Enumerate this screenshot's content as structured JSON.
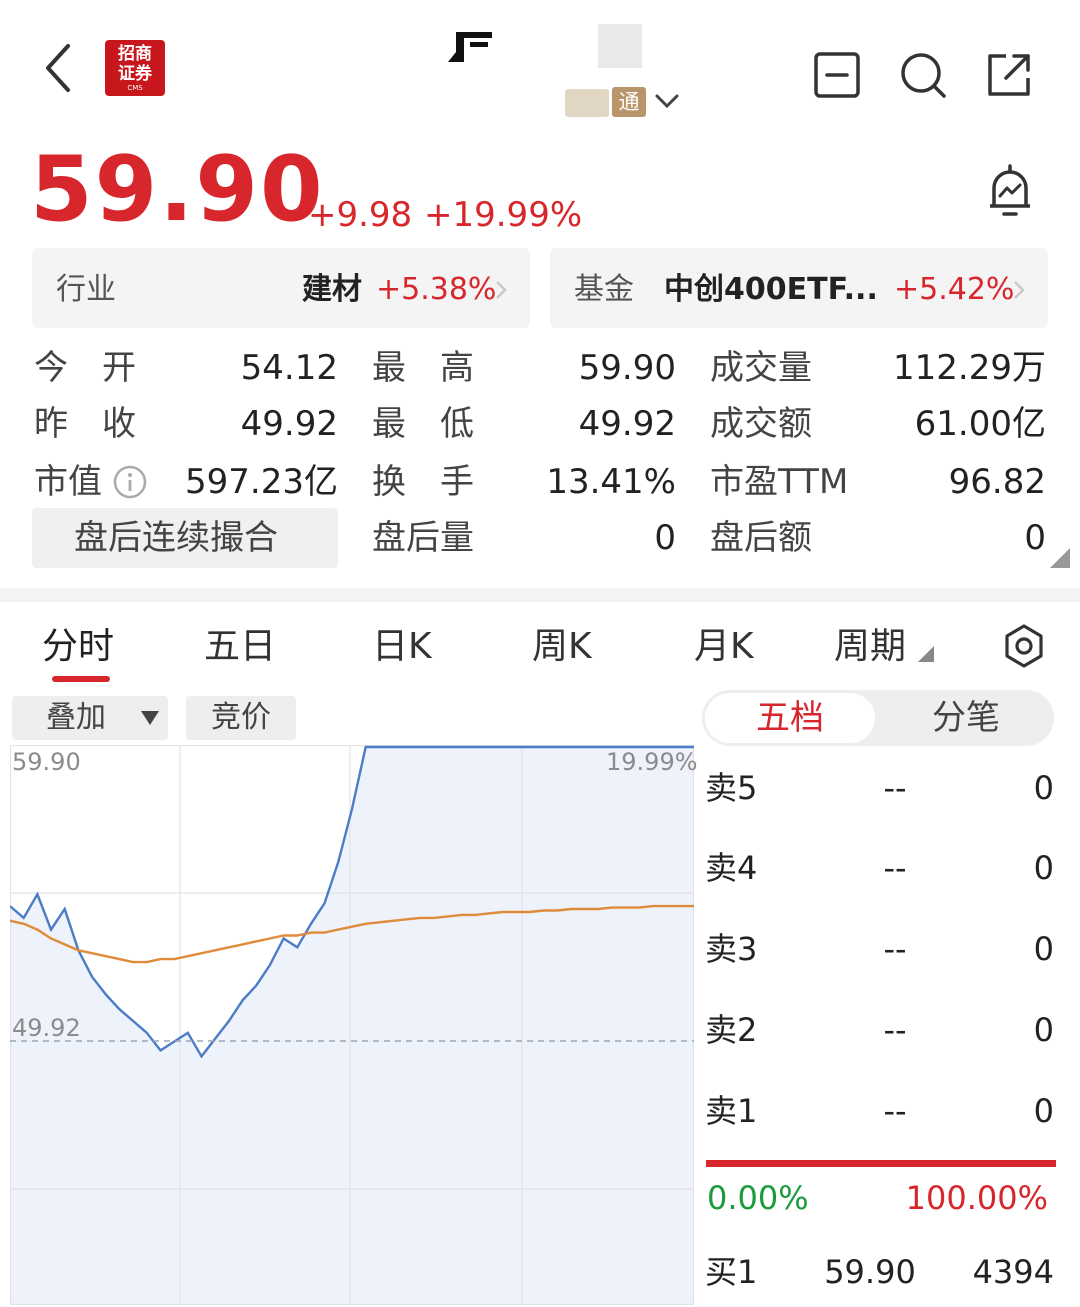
{
  "header": {
    "logo_line1": "招商",
    "logo_line2": "证券",
    "logo_sub": "CMS",
    "tong_badge": "通"
  },
  "quote": {
    "price": "59.90",
    "change": "+9.98",
    "change_pct": "+19.99%"
  },
  "industry": {
    "label": "行业",
    "name": "建材",
    "pct": "+5.38%"
  },
  "fund": {
    "label": "基金",
    "name": "中创400ETF...",
    "pct": "+5.42%"
  },
  "stats": {
    "open_label": "今　开",
    "open": "54.12",
    "high_label": "最　高",
    "high": "59.90",
    "volume_label": "成交量",
    "volume": "112.29万",
    "prev_close_label": "昨　收",
    "prev_close": "49.92",
    "low_label": "最　低",
    "low": "49.92",
    "amount_label": "成交额",
    "amount": "61.00亿",
    "mcap_label": "市值",
    "mcap": "597.23亿",
    "turnover_label": "换　手",
    "turnover": "13.41%",
    "pe_label": "市盈TTM",
    "pe": "96.82",
    "after_hours_btn": "盘后连续撮合",
    "after_vol_label": "盘后量",
    "after_vol": "0",
    "after_amt_label": "盘后额",
    "after_amt": "0"
  },
  "tabs": [
    "分时",
    "五日",
    "日K",
    "周K",
    "月K",
    "周期"
  ],
  "chart_controls": {
    "overlay": "叠加",
    "auction": "竞价"
  },
  "chart_data": {
    "type": "line",
    "y_left_ticks": [
      "59.90",
      "49.92"
    ],
    "y_right_ticks": [
      "19.99%"
    ],
    "ylim": [
      47.5,
      60.5
    ],
    "x": [
      0,
      2,
      4,
      6,
      8,
      10,
      12,
      14,
      16,
      18,
      20,
      22,
      24,
      26,
      28,
      30,
      32,
      34,
      36,
      38,
      40,
      42,
      44,
      46,
      48,
      50,
      52,
      54,
      56,
      58,
      60,
      62,
      64,
      66,
      68,
      70,
      72,
      74,
      76,
      78,
      80,
      82,
      84,
      86,
      88,
      90,
      92,
      94,
      96,
      98,
      100
    ],
    "series": [
      {
        "color": "#4d7cc7",
        "values": [
          54.5,
          54.1,
          54.9,
          53.7,
          54.4,
          53.0,
          52.1,
          51.5,
          51.0,
          50.6,
          50.2,
          49.6,
          49.9,
          50.2,
          49.4,
          50.0,
          50.6,
          51.3,
          51.8,
          52.5,
          53.4,
          53.1,
          53.9,
          54.6,
          56.0,
          57.8,
          59.9,
          59.9,
          59.9,
          59.9,
          59.9,
          59.9,
          59.9,
          59.9,
          59.9,
          59.9,
          59.9,
          59.9,
          59.9,
          59.9,
          59.9,
          59.9,
          59.9,
          59.9,
          59.9,
          59.9,
          59.9,
          59.9,
          59.9,
          59.9,
          59.9
        ]
      },
      {
        "color": "#e08b3a",
        "values": [
          54.0,
          53.9,
          53.7,
          53.4,
          53.2,
          53.0,
          52.9,
          52.8,
          52.7,
          52.6,
          52.6,
          52.7,
          52.7,
          52.8,
          52.9,
          53.0,
          53.1,
          53.2,
          53.3,
          53.4,
          53.5,
          53.5,
          53.6,
          53.6,
          53.7,
          53.8,
          53.9,
          53.95,
          54.0,
          54.05,
          54.1,
          54.1,
          54.15,
          54.2,
          54.2,
          54.25,
          54.3,
          54.3,
          54.3,
          54.35,
          54.35,
          54.4,
          54.4,
          54.4,
          54.45,
          54.45,
          54.45,
          54.5,
          54.5,
          54.5,
          54.5
        ]
      }
    ],
    "prev_close": 49.92,
    "grid": true
  },
  "orderbook": {
    "tab_five": "五档",
    "tab_tick": "分笔",
    "rows": [
      {
        "label": "卖5",
        "price": "--",
        "vol": "0"
      },
      {
        "label": "卖4",
        "price": "--",
        "vol": "0"
      },
      {
        "label": "卖3",
        "price": "--",
        "vol": "0"
      },
      {
        "label": "卖2",
        "price": "--",
        "vol": "0"
      },
      {
        "label": "卖1",
        "price": "--",
        "vol": "0"
      }
    ],
    "ratio_left": "0.00%",
    "ratio_right": "100.00%",
    "bid1": {
      "label": "买1",
      "price": "59.90",
      "vol": "4394"
    }
  }
}
